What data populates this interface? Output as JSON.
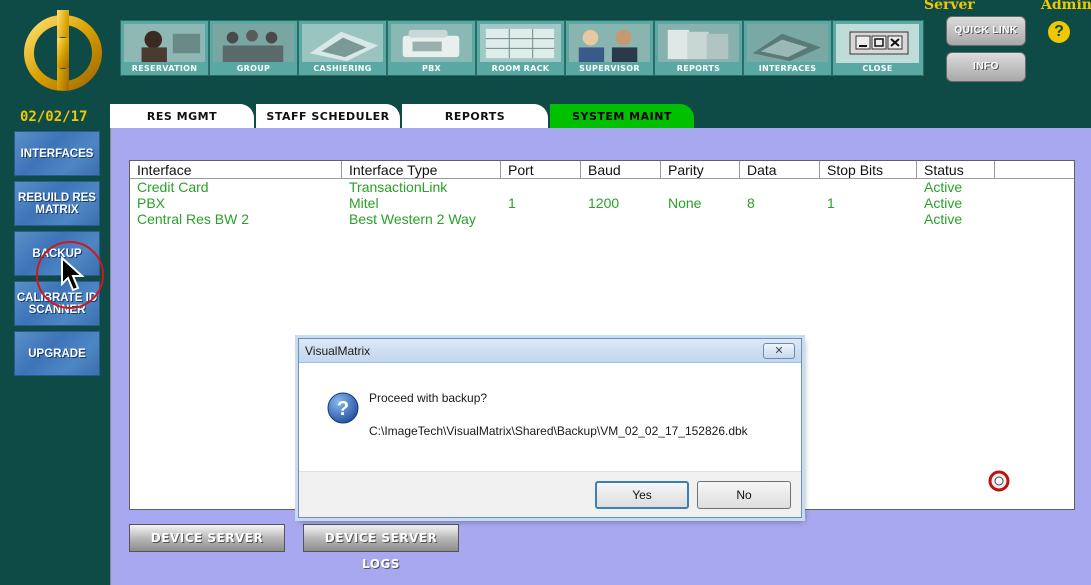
{
  "header": {
    "server_label": "Server",
    "admin_label": "Admin",
    "help_label": "?",
    "quick_link_label": "QUICK LINK",
    "info_label": "INFO",
    "date": "02/02/17"
  },
  "toolbar": {
    "buttons": [
      {
        "label": "RESERVATION",
        "icon": "reservation-photo"
      },
      {
        "label": "GROUP",
        "icon": "group-photo"
      },
      {
        "label": "CASHIERING",
        "icon": "cashiering-photo"
      },
      {
        "label": "PBX",
        "icon": "pbx-photo"
      },
      {
        "label": "ROOM RACK",
        "icon": "room-rack-photo"
      },
      {
        "label": "SUPERVISOR",
        "icon": "supervisor-photo"
      },
      {
        "label": "REPORTS",
        "icon": "reports-photo"
      },
      {
        "label": "INTERFACES",
        "icon": "interfaces-photo"
      },
      {
        "label": "CLOSE",
        "icon": "window-close-icon"
      }
    ]
  },
  "tabs": [
    {
      "label": "RES MGMT",
      "active": false
    },
    {
      "label": "STAFF SCHEDULER",
      "active": false
    },
    {
      "label": "REPORTS",
      "active": false
    },
    {
      "label": "SYSTEM MAINT",
      "active": true
    }
  ],
  "sidenav": {
    "items": [
      {
        "label_line1": "INTERFACES",
        "label_line2": ""
      },
      {
        "label_line1": "REBUILD RES",
        "label_line2": "MATRIX"
      },
      {
        "label_line1": "BACKUP",
        "label_line2": ""
      },
      {
        "label_line1": "CALIBRATE ID",
        "label_line2": "SCANNER"
      },
      {
        "label_line1": "UPGRADE",
        "label_line2": ""
      }
    ]
  },
  "grid": {
    "columns": [
      "Interface",
      "Interface Type",
      "Port",
      "Baud",
      "Parity",
      "Data",
      "Stop Bits",
      "Status"
    ],
    "rows": [
      [
        "Credit Card",
        "TransactionLink",
        "",
        "",
        "",
        "",
        "",
        "Active"
      ],
      [
        "PBX",
        "Mitel",
        "1",
        "1200",
        "None",
        "8",
        "1",
        "Active"
      ],
      [
        "Central Res BW 2",
        "Best Western 2 Way",
        "",
        "",
        "",
        "",
        "",
        "Active"
      ]
    ]
  },
  "bottom_buttons": {
    "device_server": "DEVICE SERVER",
    "device_server_logs": "DEVICE SERVER LOGS"
  },
  "dialog": {
    "title": "VisualMatrix",
    "close_label": "✕",
    "message": "Proceed with backup?",
    "path": "C:\\ImageTech\\VisualMatrix\\Shared\\Backup\\VM_02_02_17_152826.dbk",
    "yes_label": "Yes",
    "no_label": "No"
  },
  "colors": {
    "background": "#0e4a46",
    "panel": "#a8a8f0",
    "accent_gold": "#f0c800",
    "active_tab": "#00c000",
    "grid_text": "#2aa02a",
    "side_button": "#3d74b8"
  }
}
